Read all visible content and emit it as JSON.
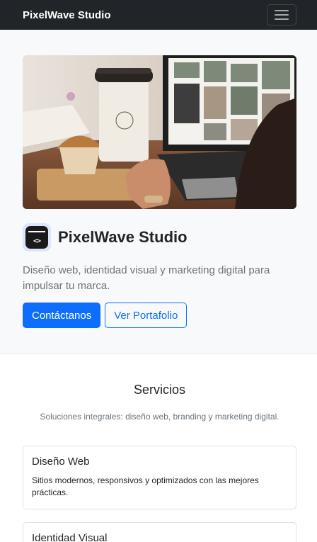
{
  "navbar": {
    "brand": "PixelWave Studio",
    "toggle_icon": "hamburger-menu-icon"
  },
  "hero": {
    "image_alt": "Coffee cup, muffin and laptop on a desk",
    "title": "PixelWave Studio",
    "subtitle": "Diseño web, identidad visual y marketing digital para impulsar tu marca.",
    "primary_button": "Contáctanos",
    "secondary_button": "Ver Portafolio",
    "logo_icon": "code-window-icon",
    "logo_code": "<>"
  },
  "services": {
    "title": "Servicios",
    "subtitle": "Soluciones integrales: diseño web, branding y marketing digital.",
    "cards": [
      {
        "title": "Diseño Web",
        "text": "Sitios modernos, responsivos y optimizados con las mejores prácticas."
      },
      {
        "title": "Identidad Visual",
        "text": ""
      }
    ]
  },
  "colors": {
    "navbar_bg": "#212529",
    "primary": "#0d6efd",
    "hero_bg": "#f8f9fa"
  }
}
